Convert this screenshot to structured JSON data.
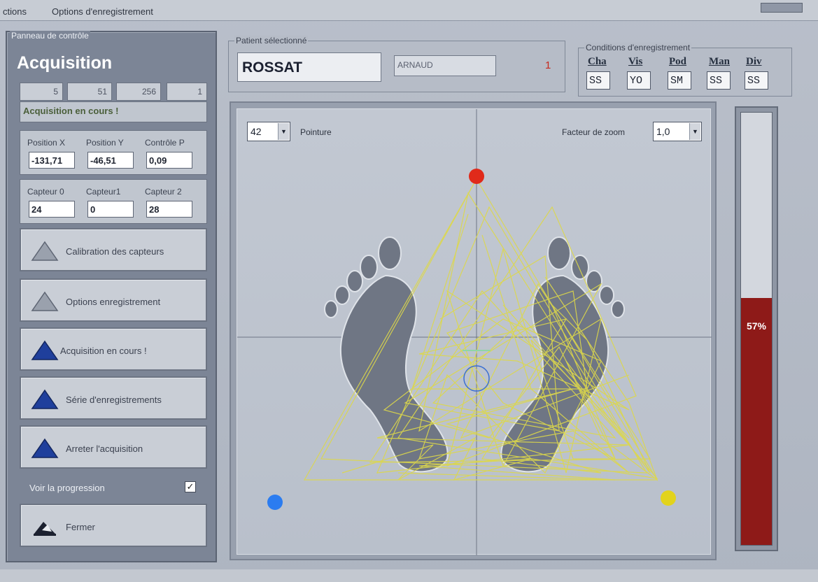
{
  "menu": {
    "items": [
      "ctions",
      "Options d'enregistrement"
    ]
  },
  "control_panel": {
    "legend": "Panneau de contrôle",
    "title": "Acquisition",
    "counters": [
      "5",
      "51",
      "256",
      "1"
    ],
    "status": "Acquisition en cours !",
    "position": {
      "labels": [
        "Position X",
        "Position Y",
        "Contrôle P"
      ],
      "values": [
        "-131,71",
        "-46,51",
        "0,09"
      ]
    },
    "sensors": {
      "labels": [
        "Capteur 0",
        "Capteur1",
        "Capteur 2"
      ],
      "values": [
        "24",
        "0",
        "28"
      ]
    },
    "buttons": [
      {
        "label": "Calibration des capteurs",
        "icon": "triangle-gray-icon"
      },
      {
        "label": "Options enregistrement",
        "icon": "triangle-gray-icon"
      },
      {
        "label": "Acquisition en cours !",
        "icon": "triangle-blue-icon"
      },
      {
        "label": "Série d'enregistrements",
        "icon": "triangle-blue-icon"
      },
      {
        "label": "Arreter l'acquisition",
        "icon": "triangle-blue-icon"
      }
    ],
    "progress_label": "Voir la progression",
    "progress_checked": true,
    "close_label": "Fermer"
  },
  "patient": {
    "legend": "Patient sélectionné",
    "last_name": "ROSSAT",
    "first_name": "ARNAUD",
    "number": "1"
  },
  "conditions": {
    "legend": "Conditions d'enregistrement",
    "items": [
      {
        "label": "Cha",
        "value": "SS"
      },
      {
        "label": "Vis",
        "value": "YO"
      },
      {
        "label": "Pod",
        "value": "SM"
      },
      {
        "label": "Man",
        "value": "SS"
      },
      {
        "label": "Div",
        "value": "SS"
      }
    ]
  },
  "plot": {
    "shoe_size": "42",
    "shoe_size_label": "Pointure",
    "zoom_label": "Facteur de zoom",
    "zoom": "1,0",
    "sensor_colors": {
      "top": "#e02a1a",
      "left": "#2b7cf0",
      "right": "#e2d31c"
    },
    "trace_color": "#ddd84a"
  },
  "gauge": {
    "percent": 57,
    "text": "57%",
    "color": "#8e1a18"
  }
}
